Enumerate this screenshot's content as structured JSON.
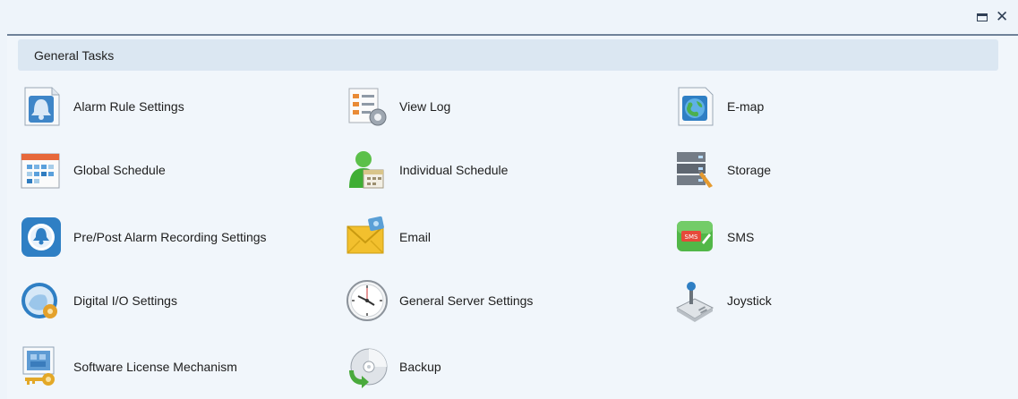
{
  "window": {
    "maximize_icon": "maximize-icon",
    "close_icon": "close-icon",
    "close_glyph": "✕"
  },
  "section": {
    "title": "General Tasks"
  },
  "tasks": [
    {
      "label": "Alarm Rule Settings",
      "icon": "alarm-rule-icon"
    },
    {
      "label": "View Log",
      "icon": "view-log-icon"
    },
    {
      "label": "E-map",
      "icon": "emap-icon"
    },
    {
      "label": "Global Schedule",
      "icon": "calendar-icon"
    },
    {
      "label": "Individual Schedule",
      "icon": "user-calendar-icon"
    },
    {
      "label": "Storage",
      "icon": "storage-icon"
    },
    {
      "label": "Pre/Post Alarm Recording Settings",
      "icon": "alarm-clock-icon"
    },
    {
      "label": "Email",
      "icon": "envelope-icon"
    },
    {
      "label": "SMS",
      "icon": "sms-icon"
    },
    {
      "label": "Digital I/O Settings",
      "icon": "digital-io-icon"
    },
    {
      "label": "General Server Settings",
      "icon": "clock-icon"
    },
    {
      "label": "Joystick",
      "icon": "joystick-icon"
    },
    {
      "label": "Software License Mechanism",
      "icon": "license-key-icon"
    },
    {
      "label": "Backup",
      "icon": "backup-disc-icon"
    }
  ],
  "colors": {
    "background": "#eef4fa",
    "header_bar": "#dbe7f2",
    "top_line": "#6f8299"
  }
}
